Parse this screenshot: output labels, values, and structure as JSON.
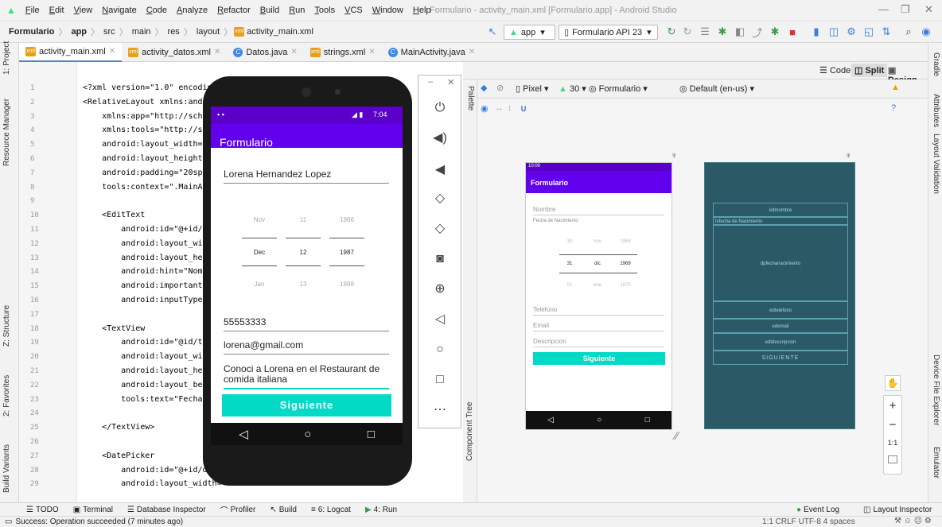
{
  "menu": [
    "File",
    "Edit",
    "View",
    "Navigate",
    "Code",
    "Analyze",
    "Refactor",
    "Build",
    "Run",
    "Tools",
    "VCS",
    "Window",
    "Help"
  ],
  "window_title": "Formulario - activity_main.xml [Formulario.app] - Android Studio",
  "breadcrumbs": [
    "Formulario",
    "app",
    "src",
    "main",
    "res",
    "layout",
    "activity_main.xml"
  ],
  "toolbar": {
    "app_config": "app",
    "device": "Formulario API 23"
  },
  "tabs": [
    "activity_main.xml",
    "activity_datos.xml",
    "Datos.java",
    "strings.xml",
    "MainActivity.java"
  ],
  "view_modes": {
    "code": "Code",
    "split": "Split",
    "design": "Design"
  },
  "left_tools": [
    "1: Project",
    "Resource Manager",
    "Z: Structure",
    "2: Favorites",
    "Build Variants"
  ],
  "right_tools": [
    "Gradle",
    "Attributes",
    "Layout Validation",
    "Device File Explorer",
    "Emulator"
  ],
  "code_lines": [
    {
      "n": "1",
      "t": "<?xml version=\"1.0\" encoding=\""
    },
    {
      "n": "2",
      "t": "<RelativeLayout xmlns:android"
    },
    {
      "n": "3",
      "t": "    xmlns:app=\"http://schemas"
    },
    {
      "n": "4",
      "t": "    xmlns:tools=\"http://schem"
    },
    {
      "n": "5",
      "t": "    android:layout_width=\"mat"
    },
    {
      "n": "6",
      "t": "    android:layout_height=\"ma"
    },
    {
      "n": "7",
      "t": "    android:padding=\"20sp\""
    },
    {
      "n": "8",
      "t": "    tools:context=\".MainActiv"
    },
    {
      "n": "9",
      "t": ""
    },
    {
      "n": "10",
      "t": "    <EditText"
    },
    {
      "n": "11",
      "t": "        android:id=\"@+id/edtn"
    },
    {
      "n": "12",
      "t": "        android:layout_width="
    },
    {
      "n": "13",
      "t": "        android:layout_height"
    },
    {
      "n": "14",
      "t": "        android:hint=\"Nombre\""
    },
    {
      "n": "15",
      "t": "        android:importantForA"
    },
    {
      "n": "16",
      "t": "        android:inputType=\"te"
    },
    {
      "n": "17",
      "t": ""
    },
    {
      "n": "18",
      "t": "    <TextView"
    },
    {
      "n": "19",
      "t": "        android:id=\"@id/tvfec"
    },
    {
      "n": "20",
      "t": "        android:layout_width="
    },
    {
      "n": "21",
      "t": "        android:layout_height"
    },
    {
      "n": "22",
      "t": "        android:layout_below="
    },
    {
      "n": "23",
      "t": "        tools:text=\"Fecha de"
    },
    {
      "n": "24",
      "t": ""
    },
    {
      "n": "25",
      "t": "    </TextView>"
    },
    {
      "n": "26",
      "t": ""
    },
    {
      "n": "27",
      "t": "    <DatePicker"
    },
    {
      "n": "28",
      "t": "        android:id=\"@+id/dpfe"
    },
    {
      "n": "29",
      "t": "        android:layout_width="
    }
  ],
  "emulator": {
    "time": "7:04",
    "app_title": "Formulario",
    "name": "Lorena Hernandez Lopez",
    "picker_prev": [
      "Nov",
      "11",
      "1986"
    ],
    "picker_sel": [
      "Dec",
      "12",
      "1987"
    ],
    "picker_next": [
      "Jan",
      "13",
      "1988"
    ],
    "phone": "55553333",
    "email": "lorena@gmail.com",
    "desc": "Conoci a Lorena en el Restaurant de comida italiana",
    "button": "Siguiente"
  },
  "design_toolbar": {
    "device": "Pixel",
    "api": "30",
    "theme": "Formulario",
    "locale": "Default (en-us)"
  },
  "preview": {
    "time": "10:00",
    "title": "Formulario",
    "hint_nombre": "Nombre",
    "label_fecha": "Fecha de Nacimiento",
    "prev": [
      "30",
      "nov",
      "1968"
    ],
    "sel": [
      "31",
      "dic",
      "1969"
    ],
    "next": [
      "01",
      "ene",
      "1970"
    ],
    "hint_tel": "Telefono",
    "hint_email": "Email",
    "hint_desc": "Descripcion",
    "button": "Siguiente"
  },
  "blueprint": {
    "b1": "edtnombre",
    "b2": "tvfecha de Nacimiento",
    "b3": "dpfechanacimiento",
    "b4": "edtelefono",
    "b5": "edemail",
    "b6": "edtdescripcion",
    "b7": "SIGUIENTE"
  },
  "zoom": {
    "plus": "+",
    "minus": "−",
    "ratio": "1:1"
  },
  "component_tree": "Component Tree",
  "palette": "Palette",
  "bottom_tools": [
    "TODO",
    "Terminal",
    "Database Inspector",
    "Profiler",
    "Build",
    "6: Logcat",
    "4: Run"
  ],
  "bottom_right": [
    "Event Log",
    "Layout Inspector"
  ],
  "status_msg": "Success: Operation succeeded (7 minutes ago)",
  "status_right": "1:1  CRLF  UTF-8  4 spaces"
}
